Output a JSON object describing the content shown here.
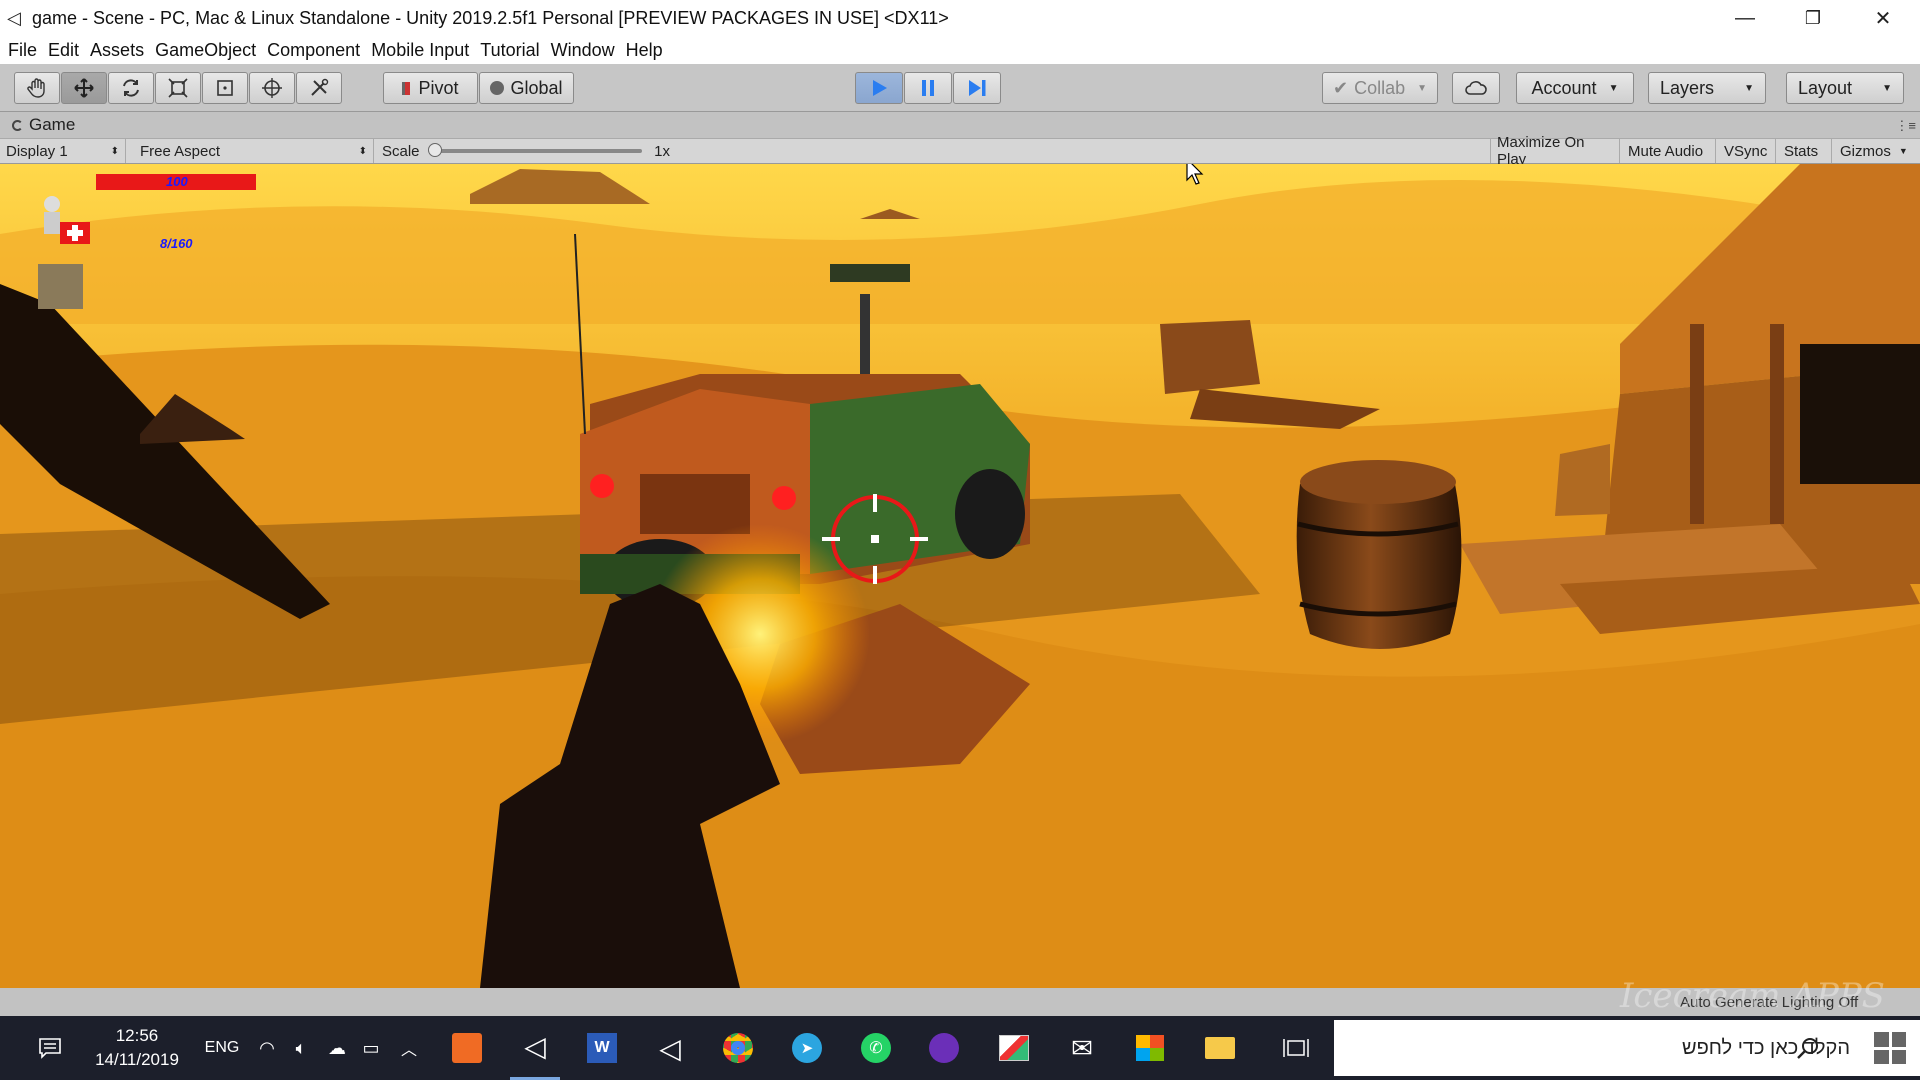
{
  "window": {
    "title": "game - Scene - PC, Mac & Linux Standalone - Unity 2019.2.5f1 Personal [PREVIEW PACKAGES IN USE] <DX11>",
    "minimize": "—",
    "restore": "❐",
    "close": "✕"
  },
  "menu": [
    "File",
    "Edit",
    "Assets",
    "GameObject",
    "Component",
    "Mobile Input",
    "Tutorial",
    "Window",
    "Help"
  ],
  "toolbar": {
    "pivot": "Pivot",
    "global": "Global",
    "collab": "Collab",
    "account": "Account",
    "layers": "Layers",
    "layout": "Layout"
  },
  "game_panel": {
    "tab": "Game",
    "display": "Display 1",
    "aspect": "Free Aspect",
    "scale_label": "Scale",
    "scale_value": "1x",
    "scale_level": 0,
    "maximize": "Maximize On Play",
    "mute": "Mute Audio",
    "vsync": "VSync",
    "stats": "Stats",
    "gizmos": "Gizmos"
  },
  "hud": {
    "health": "100",
    "health_fraction": 1.0,
    "ammo": "8/160"
  },
  "status": {
    "message": "Auto Generate Lighting Off",
    "watermark": "Icecream APPS"
  },
  "taskbar": {
    "time": "12:56",
    "date": "14/11/2019",
    "lang": "ENG",
    "search_placeholder": "הקלד כאן כדי לחפש",
    "apps": [
      "recorder-app",
      "unity-app",
      "word-app",
      "unity-hub-app",
      "chrome-app",
      "telegram-app",
      "whatsapp-app",
      "podcast-app",
      "paint-app",
      "mail-app",
      "store-app",
      "explorer-app"
    ]
  },
  "colors": {
    "play_blue": "#2a7df0",
    "health_red": "#e81818",
    "hud_blue": "#1a1aff",
    "sand": "#e59a1c"
  }
}
